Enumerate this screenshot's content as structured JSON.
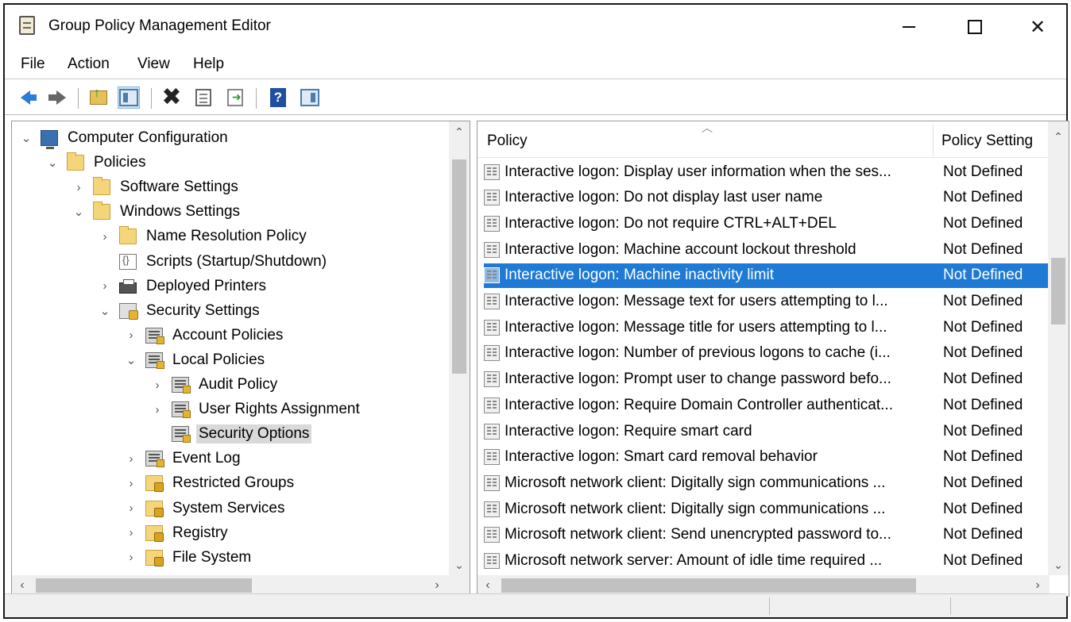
{
  "window": {
    "title": "Group Policy Management Editor"
  },
  "menu": {
    "items": [
      "File",
      "Action",
      "View",
      "Help"
    ]
  },
  "toolbar": {
    "buttons": [
      "back-arrow-icon",
      "forward-arrow-icon",
      "up-folder-icon",
      "show-hide-tree-icon",
      "delete-icon",
      "properties-icon",
      "export-list-icon",
      "help-icon",
      "show-action-pane-icon"
    ]
  },
  "tree": {
    "items": [
      {
        "label": "Computer Configuration",
        "expanded": true,
        "icon": "computer-icon"
      },
      {
        "label": "Policies",
        "expanded": true,
        "icon": "folder-icon"
      },
      {
        "label": "Software Settings",
        "expanded": false,
        "icon": "folder-icon"
      },
      {
        "label": "Windows Settings",
        "expanded": true,
        "icon": "folder-icon"
      },
      {
        "label": "Name Resolution Policy",
        "expanded": false,
        "icon": "folder-icon"
      },
      {
        "label": "Scripts (Startup/Shutdown)",
        "icon": "script-icon"
      },
      {
        "label": "Deployed Printers",
        "expanded": false,
        "icon": "printer-icon"
      },
      {
        "label": "Security Settings",
        "expanded": true,
        "icon": "security-settings-icon"
      },
      {
        "label": "Account Policies",
        "expanded": false,
        "icon": "policy-icon"
      },
      {
        "label": "Local Policies",
        "expanded": true,
        "icon": "policy-icon"
      },
      {
        "label": "Audit Policy",
        "expanded": false,
        "icon": "policy-icon"
      },
      {
        "label": "User Rights Assignment",
        "expanded": false,
        "icon": "policy-icon"
      },
      {
        "label": "Security Options",
        "selected": true,
        "icon": "policy-icon"
      },
      {
        "label": "Event Log",
        "expanded": false,
        "icon": "policy-icon"
      },
      {
        "label": "Restricted Groups",
        "expanded": false,
        "icon": "lock-folder-icon"
      },
      {
        "label": "System Services",
        "expanded": false,
        "icon": "lock-folder-icon"
      },
      {
        "label": "Registry",
        "expanded": false,
        "icon": "lock-folder-icon"
      },
      {
        "label": "File System",
        "expanded": false,
        "icon": "lock-folder-icon"
      }
    ]
  },
  "list": {
    "columns": {
      "policy": "Policy",
      "setting": "Policy Setting"
    },
    "rows": [
      {
        "policy": "Interactive logon: Display user information when the ses...",
        "setting": "Not Defined"
      },
      {
        "policy": "Interactive logon: Do not display last user name",
        "setting": "Not Defined"
      },
      {
        "policy": "Interactive logon: Do not require CTRL+ALT+DEL",
        "setting": "Not Defined"
      },
      {
        "policy": "Interactive logon: Machine account lockout threshold",
        "setting": "Not Defined"
      },
      {
        "policy": "Interactive logon: Machine inactivity limit",
        "setting": "Not Defined",
        "selected": true
      },
      {
        "policy": "Interactive logon: Message text for users attempting to l...",
        "setting": "Not Defined"
      },
      {
        "policy": "Interactive logon: Message title for users attempting to l...",
        "setting": "Not Defined"
      },
      {
        "policy": "Interactive logon: Number of previous logons to cache (i...",
        "setting": "Not Defined"
      },
      {
        "policy": "Interactive logon: Prompt user to change password befo...",
        "setting": "Not Defined"
      },
      {
        "policy": "Interactive logon: Require Domain Controller authenticat...",
        "setting": "Not Defined"
      },
      {
        "policy": "Interactive logon: Require smart card",
        "setting": "Not Defined"
      },
      {
        "policy": "Interactive logon: Smart card removal behavior",
        "setting": "Not Defined"
      },
      {
        "policy": "Microsoft network client: Digitally sign communications ...",
        "setting": "Not Defined"
      },
      {
        "policy": "Microsoft network client: Digitally sign communications ...",
        "setting": "Not Defined"
      },
      {
        "policy": "Microsoft network client: Send unencrypted password to...",
        "setting": "Not Defined"
      },
      {
        "policy": "Microsoft network server: Amount of idle time required ...",
        "setting": "Not Defined"
      }
    ]
  },
  "colors": {
    "selection": "#1e7ad4",
    "tree_selection": "#d9d9d9"
  }
}
